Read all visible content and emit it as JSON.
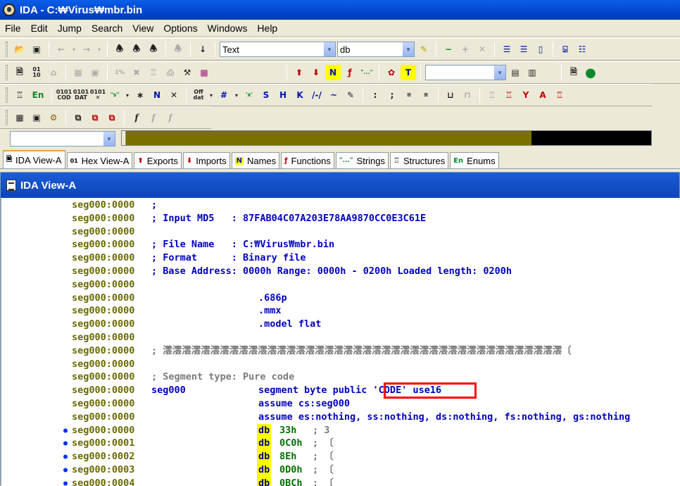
{
  "window": {
    "title": "IDA - C:₩Virus₩mbr.bin"
  },
  "menu": [
    "File",
    "Edit",
    "Jump",
    "Search",
    "View",
    "Options",
    "Windows",
    "Help"
  ],
  "toolbar": {
    "text_combo": "Text",
    "type_combo": "db",
    "seg_combo": ""
  },
  "tabs": [
    {
      "label": "IDA View-A",
      "icon": "document-icon",
      "active": true
    },
    {
      "label": "Hex View-A",
      "icon": "hex-icon"
    },
    {
      "label": "Exports",
      "icon": "exports-icon"
    },
    {
      "label": "Imports",
      "icon": "imports-icon"
    },
    {
      "label": "Names",
      "icon": "names-icon"
    },
    {
      "label": "Functions",
      "icon": "functions-icon"
    },
    {
      "label": "Strings",
      "icon": "strings-icon"
    },
    {
      "label": "Structures",
      "icon": "structures-icon"
    },
    {
      "label": "Enums",
      "icon": "enums-icon"
    }
  ],
  "panel": {
    "title": "IDA View-A"
  },
  "listing": [
    {
      "addr": "seg000:0000",
      "comment": ";"
    },
    {
      "addr": "seg000:0000",
      "comment": "; Input MD5   : 87FAB04C07A203E78AA9870CC0E3C61E"
    },
    {
      "addr": "seg000:0000"
    },
    {
      "addr": "seg000:0000",
      "comment": "; File Name   : C:₩Virus₩mbr.bin"
    },
    {
      "addr": "seg000:0000",
      "comment": "; Format      : Binary file"
    },
    {
      "addr": "seg000:0000",
      "comment": "; Base Address: 0000h Range: 0000h - 0200h Loaded length: 0200h"
    },
    {
      "addr": "seg000:0000"
    },
    {
      "addr": "seg000:0000",
      "ins": ".686p"
    },
    {
      "addr": "seg000:0000",
      "ins": ".mmx"
    },
    {
      "addr": "seg000:0000",
      "ins": ".model flat"
    },
    {
      "addr": "seg000:0000"
    },
    {
      "addr": "seg000:0000",
      "gray": "; 澐澐澐澐澐澐澐澐澐澐澐澐澐澐澐澐澐澐澐澐澐澐澐澐澐澐澐澐澐澐澐澐澐澐澐澐澐澐澐澐澐澐〔"
    },
    {
      "addr": "seg000:0000"
    },
    {
      "addr": "seg000:0000",
      "gray": "; Segment type: Pure code"
    },
    {
      "addr": "seg000:0000",
      "label": "seg000",
      "ins": "segment byte public 'CODE' use16"
    },
    {
      "addr": "seg000:0000",
      "ins": "assume cs:seg000"
    },
    {
      "addr": "seg000:0000",
      "ins": "assume es:nothing, ss:nothing, ds:nothing, fs:nothing, gs:nothing"
    },
    {
      "addr": "seg000:0000",
      "bullet": true,
      "db": "db",
      "val": "33h",
      "dcmt": "; 3"
    },
    {
      "addr": "seg000:0001",
      "bullet": true,
      "db": "db",
      "val": "0C0h",
      "dcmt": "; 〔"
    },
    {
      "addr": "seg000:0002",
      "bullet": true,
      "db": "db",
      "val": "8Eh",
      "dcmt": "; 〔"
    },
    {
      "addr": "seg000:0003",
      "bullet": true,
      "db": "db",
      "val": "0D0h",
      "dcmt": "; 〔"
    },
    {
      "addr": "seg000:0004",
      "bullet": true,
      "db": "db",
      "val": "0BCh",
      "dcmt": "; 〔"
    }
  ]
}
